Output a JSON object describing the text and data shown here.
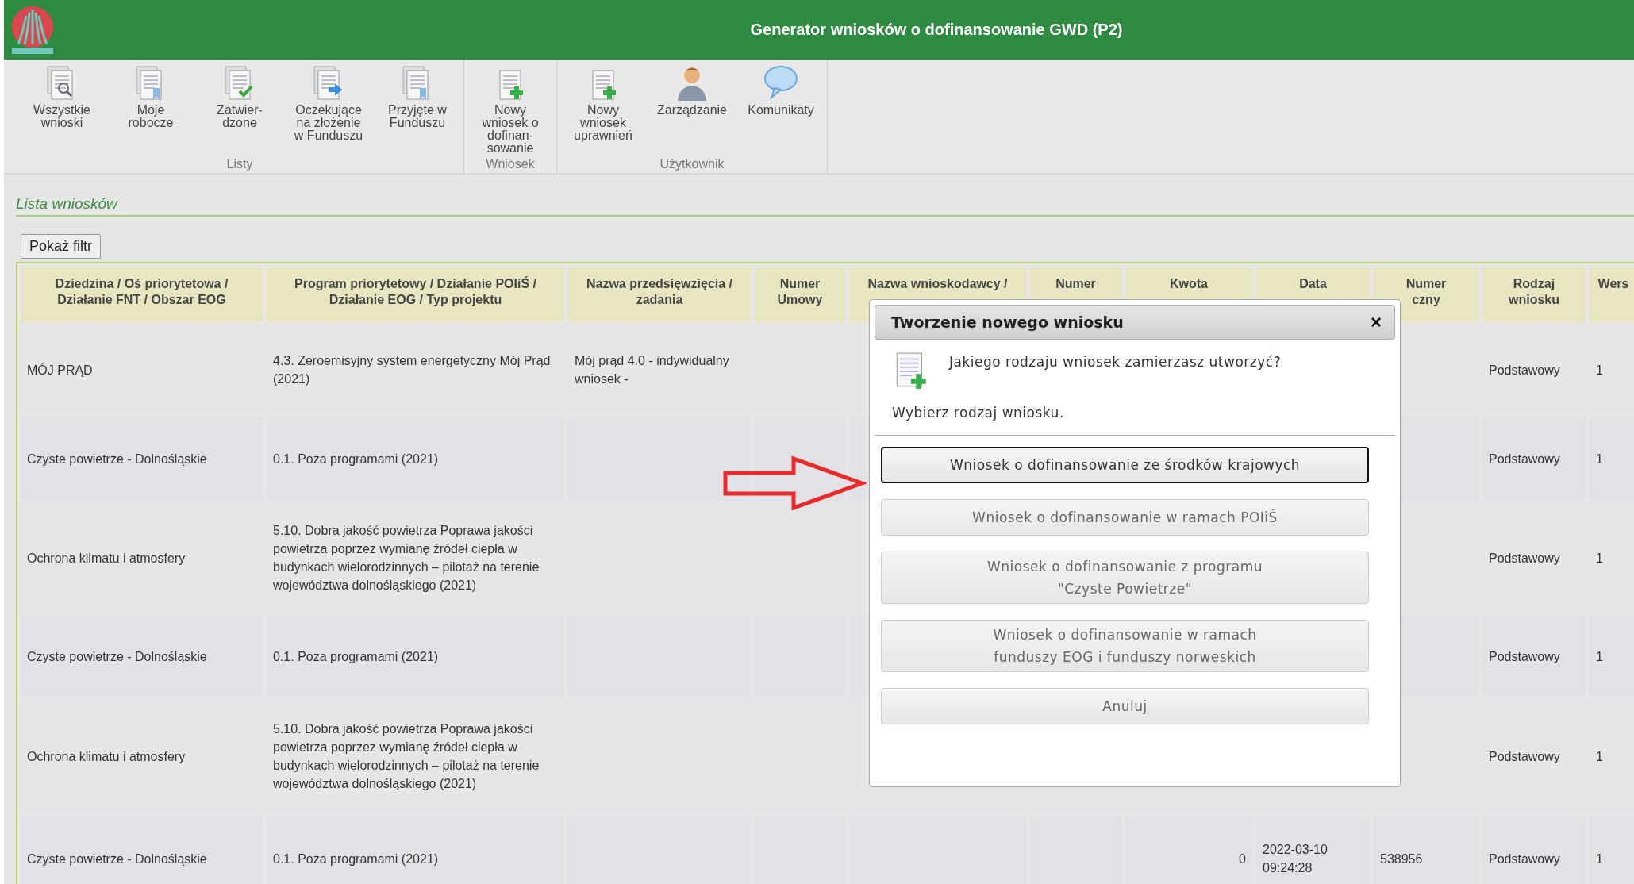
{
  "header": {
    "title": "Generator wniosków o dofinansowanie GWD (P2)"
  },
  "toolbar": {
    "groups": [
      {
        "label": "Listy",
        "items": [
          {
            "label": "Wszystkie\nwnioski",
            "kind": "search"
          },
          {
            "label": "Moje\nrobocze",
            "kind": "docs"
          },
          {
            "label": "Zatwier-\ndzone",
            "kind": "check"
          },
          {
            "label": "Oczekujące\nna złożenie\nw Funduszu",
            "kind": "send"
          },
          {
            "label": "Przyjęte w\nFunduszu",
            "kind": "docs"
          }
        ]
      },
      {
        "label": "Wniosek",
        "items": [
          {
            "label": "Nowy\nwniosek o\ndofinan-\nsowanie",
            "kind": "new"
          }
        ]
      },
      {
        "label": "Użytkownik",
        "items": [
          {
            "label": "Nowy\nwniosek\nuprawnień",
            "kind": "new"
          },
          {
            "label": "Zarządzanie",
            "kind": "user"
          },
          {
            "label": "Komunikaty",
            "kind": "chat"
          }
        ]
      }
    ]
  },
  "section_title": "Lista wniosków",
  "filter_button": "Pokaż filtr",
  "table": {
    "columns": [
      {
        "lines": [
          "Dziedzina / Oś priorytetowa /",
          "Działanie FNT / Obszar EOG"
        ]
      },
      {
        "lines": [
          "Program priorytetowy / Działanie POIiŚ /",
          "Działanie EOG / Typ projektu"
        ]
      },
      {
        "lines": [
          "Nazwa przedsięwzięcia /",
          "zadania"
        ]
      },
      {
        "lines": [
          "Numer",
          "Umowy"
        ]
      },
      {
        "lines": [
          "Nazwa wnioskodawcy /"
        ]
      },
      {
        "lines": [
          "Numer"
        ]
      },
      {
        "lines": [
          "Kwota"
        ]
      },
      {
        "lines": [
          "Data"
        ]
      },
      {
        "lines": [
          "Numer",
          "czny"
        ]
      },
      {
        "lines": [
          "Rodzaj",
          "wniosku"
        ]
      },
      {
        "lines": [
          "Wers"
        ]
      }
    ],
    "rows": [
      {
        "dziedzina": "MÓJ PRĄD",
        "program": "4.3. Zeroemisyjny system energetyczny Mój Prąd (2021)",
        "nazwa": "Mój prąd 4.0 - indywidualny wniosek -",
        "rodzaj": "Podstawowy",
        "wersja": "1"
      },
      {
        "dziedzina": "Czyste powietrze - Dolnośląskie",
        "program": "0.1. Poza programami (2021)",
        "rodzaj": "Podstawowy",
        "wersja": "1"
      },
      {
        "dziedzina": "Ochrona klimatu i atmosfery",
        "program": "5.10. Dobra jakość powietrza Poprawa jakości powietrza poprzez wymianę źródeł ciepła w budynkach wielorodzinnych – pilotaż na terenie województwa dolnośląskiego (2021)",
        "rodzaj": "Podstawowy",
        "wersja": "1"
      },
      {
        "dziedzina": "Czyste powietrze - Dolnośląskie",
        "program": "0.1. Poza programami (2021)",
        "rodzaj": "Podstawowy",
        "wersja": "1"
      },
      {
        "dziedzina": "Ochrona klimatu i atmosfery",
        "program": "5.10. Dobra jakość powietrza Poprawa jakości powietrza poprzez wymianę źródeł ciepła w budynkach wielorodzinnych – pilotaż na terenie województwa dolnośląskiego (2021)",
        "rodzaj": "Podstawowy",
        "wersja": "1"
      },
      {
        "dziedzina": "Czyste powietrze - Dolnośląskie",
        "program": "0.1. Poza programami (2021)",
        "kwota": "0",
        "data": "2022-03-10 09:24:28",
        "numer": "538956",
        "rodzaj": "Podstawowy",
        "wersja": "1"
      }
    ]
  },
  "dialog": {
    "title": "Tworzenie nowego wniosku",
    "close": "×",
    "question": "Jakiego rodzaju wniosek zamierzasz utworzyć?",
    "hint": "Wybierz rodzaj wniosku.",
    "buttons": [
      {
        "label": "Wniosek o dofinansowanie ze środków krajowych",
        "focused": true
      },
      {
        "label": "Wniosek o dofinansowanie w ramach POIiŚ",
        "focused": false
      },
      {
        "label": "Wniosek o dofinansowanie z programu\n\"Czyste Powietrze\"",
        "focused": false
      },
      {
        "label": "Wniosek o dofinansowanie w ramach\nfunduszy EOG i funduszy norweskich",
        "focused": false
      },
      {
        "label": "Anuluj",
        "focused": false
      }
    ]
  }
}
